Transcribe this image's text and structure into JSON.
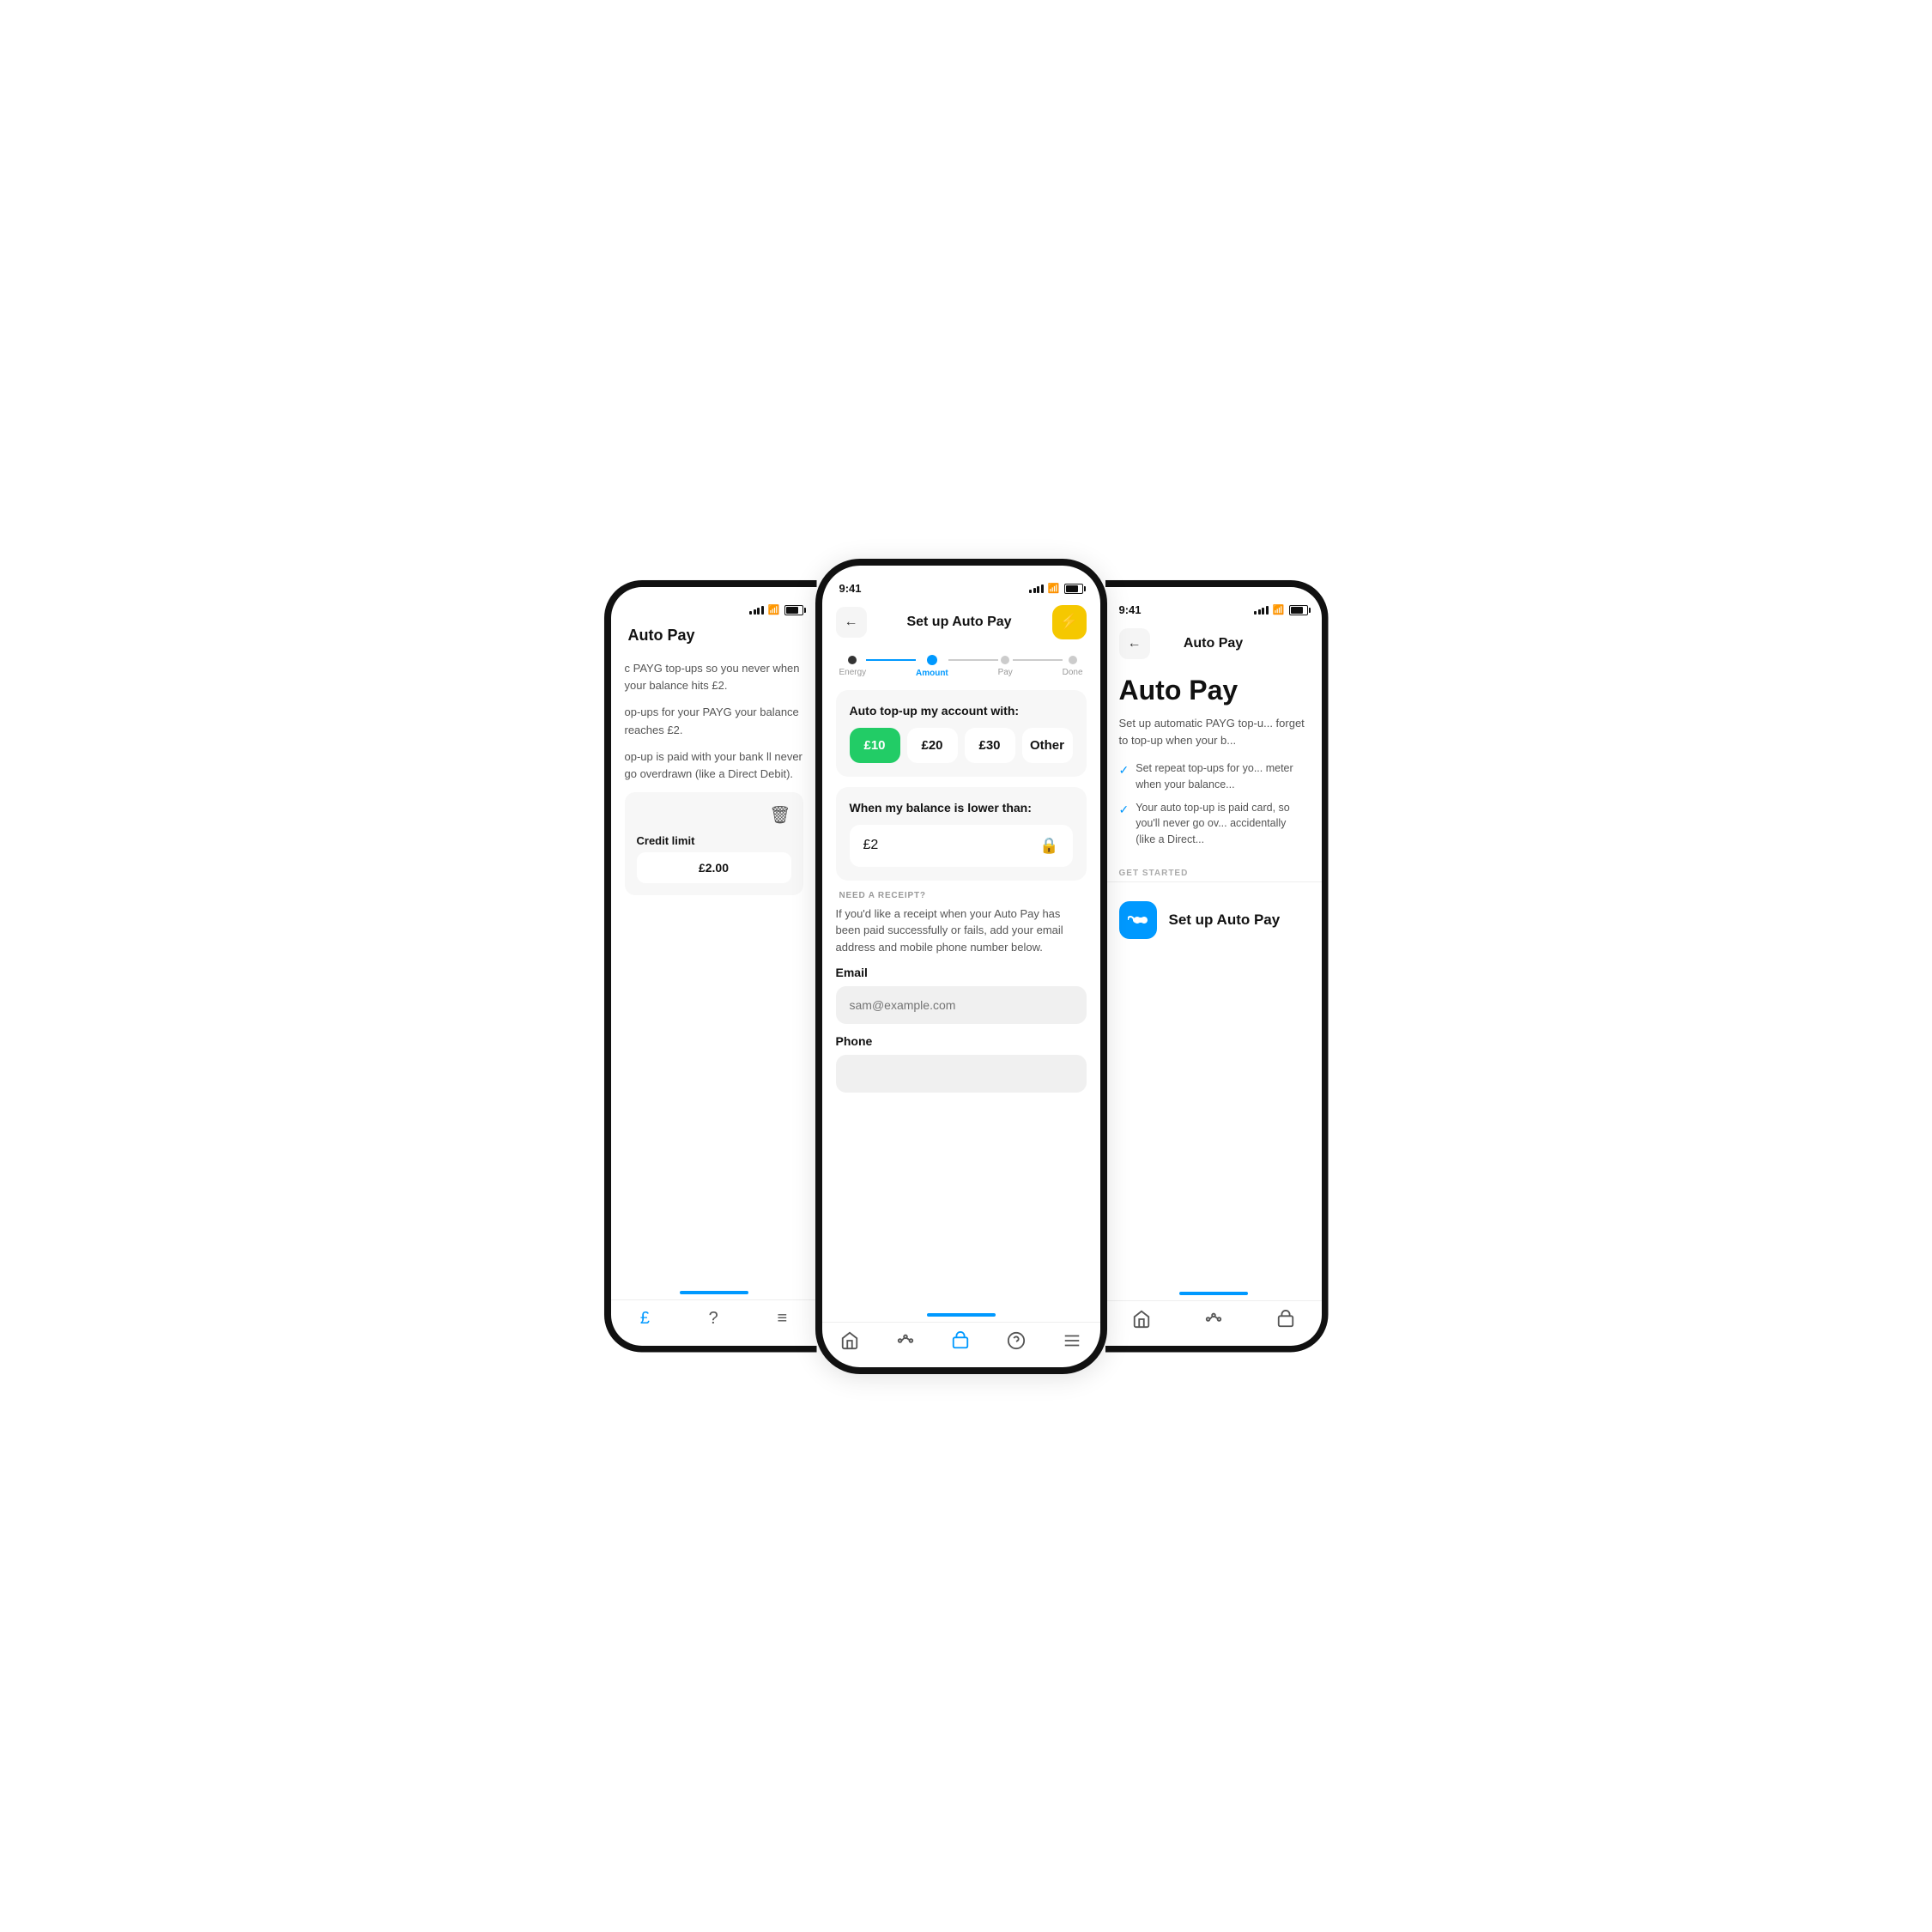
{
  "phones": {
    "left": {
      "time": "",
      "page_title": "Auto Pay",
      "description1": "c PAYG top-ups so you never when your balance hits £2.",
      "description2": "op-ups for your PAYG your balance reaches £2.",
      "description3": "op-up is paid with your bank ll never go overdrawn (like a Direct Debit).",
      "credit_limit_label": "Credit limit",
      "credit_limit_value": "£2.00",
      "nav_icons": [
        "£",
        "?",
        "≡"
      ]
    },
    "center": {
      "time": "9:41",
      "back_label": "←",
      "title": "Set up Auto Pay",
      "stepper": {
        "steps": [
          "Energy",
          "Amount",
          "Pay",
          "Done"
        ],
        "active_index": 1
      },
      "top_up_card": {
        "title": "Auto top-up my account with:",
        "options": [
          "£10",
          "£20",
          "£30",
          "Other"
        ],
        "selected_index": 0
      },
      "balance_card": {
        "title": "When my balance is lower than:",
        "value": "£2"
      },
      "receipt_section": {
        "label": "NEED A RECEIPT?",
        "description": "If you'd like a receipt when your Auto Pay has been paid successfully or fails, add your email address and mobile phone number below.",
        "email_label": "Email",
        "email_placeholder": "sam@example.com",
        "phone_label": "Phone"
      },
      "nav_icons": [
        "home",
        "graph",
        "pay",
        "help",
        "menu"
      ]
    },
    "right": {
      "time": "9:41",
      "back_label": "←",
      "title": "Auto Pay",
      "page_title": "Auto Pay",
      "description": "Set up automatic PAYG top-u... forget to top-up when your b...",
      "checklist": [
        "Set repeat top-ups for yo... meter when your balance...",
        "Your auto top-up is paid card, so you'll never go ov... accidentally (like a Direct..."
      ],
      "get_started_label": "GET STARTED",
      "setup_btn_label": "Set up Auto Pay",
      "nav_icons": [
        "home",
        "graph",
        "pay"
      ]
    }
  },
  "colors": {
    "brand_blue": "#0099ff",
    "brand_green": "#22cc66",
    "brand_yellow": "#F5C800",
    "active_step": "#0099ff",
    "inactive": "#cccccc"
  }
}
